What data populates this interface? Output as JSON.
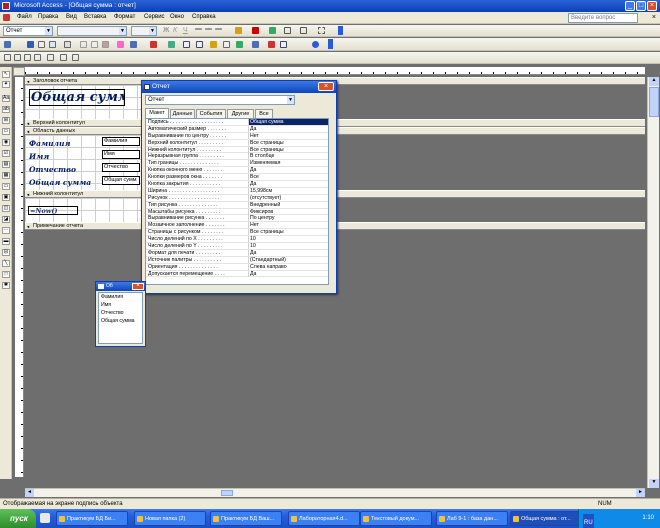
{
  "window": {
    "title": "Microsoft Access - [Общая сумма : отчет]"
  },
  "menu": {
    "items": [
      "Файл",
      "Правка",
      "Вид",
      "Вставка",
      "Формат",
      "Сервис",
      "Окно",
      "Справка"
    ],
    "ask_placeholder": "Введите вопрос"
  },
  "toolbar": {
    "object_combo": "Отчет",
    "font_combo": "",
    "size_combo": ""
  },
  "report": {
    "sections": {
      "report_header": "Заголовок отчета",
      "page_header": "Верхний колонтитул",
      "detail": "Область данных",
      "page_footer": "Нижний колонтитул",
      "report_footer": "Примечание отчета"
    },
    "title_label": "Общая сумма",
    "labels": [
      "Фамилия",
      "Имя",
      "Отчество",
      "Общая сумма"
    ],
    "fields": [
      "Фамилия",
      "Имя",
      "Отчество",
      "Общая сумм"
    ],
    "page_expr": "=Now()"
  },
  "properties": {
    "title": "Отчет",
    "object": "Отчет",
    "tabs": [
      "Макет",
      "Данные",
      "События",
      "Другие",
      "Все"
    ],
    "active_tab": "Макет",
    "rows": [
      {
        "name": "Подпись . . . . . . . . . . . . . . . . . . .",
        "value": "Общая сумма"
      },
      {
        "name": "Автоматический размер . . . . . . .",
        "value": "Да"
      },
      {
        "name": "Выравнивание по центру . . . . . .",
        "value": "Нет"
      },
      {
        "name": "Верхний колонтитул . . . . . . . . .",
        "value": "Все страницы"
      },
      {
        "name": "Нижний колонтитул . . . . . . . . .",
        "value": "Все страницы"
      },
      {
        "name": "Неразрывная группа . . . . . . . . .",
        "value": "В столбце"
      },
      {
        "name": "Тип границы . . . . . . . . . . . . . .",
        "value": "Изменяемая"
      },
      {
        "name": "Кнопка оконного меню . . . . . . .",
        "value": "Да"
      },
      {
        "name": "Кнопки размеров окна . . . . . . .",
        "value": "Все"
      },
      {
        "name": "Кнопка закрытия . . . . . . . . . . .",
        "value": "Да"
      },
      {
        "name": "Ширина . . . . . . . . . . . . . . . . . .",
        "value": "15,998см"
      },
      {
        "name": "Рисунок . . . . . . . . . . . . . . . . . .",
        "value": "(отсутствует)"
      },
      {
        "name": "Тип рисунка . . . . . . . . . . . . . .",
        "value": "Внедренный"
      },
      {
        "name": "Масштабы рисунка . . . . . . . . .",
        "value": "Фиксиров"
      },
      {
        "name": "Выравнивание рисунка . . . . . . .",
        "value": "По центру"
      },
      {
        "name": "Мозаичное заполнение . . . . . . .",
        "value": "Нет"
      },
      {
        "name": "Страницы с рисунком . . . . . . . .",
        "value": "Все страницы"
      },
      {
        "name": "Число делений по X . . . . . . . . .",
        "value": "10"
      },
      {
        "name": "Число делений по Y . . . . . . . . .",
        "value": "10"
      },
      {
        "name": "Формат для печати . . . . . . . . .",
        "value": "Да"
      },
      {
        "name": "Источник палитры . . . . . . . . . .",
        "value": "(Стандартный)"
      },
      {
        "name": "Ориентация . . . . . . . . . . . . . .",
        "value": "Слева направо"
      },
      {
        "name": "Допускается перемещение . . . .",
        "value": "Да"
      }
    ]
  },
  "fieldlist": {
    "title": "Об",
    "items": [
      "Фамилия",
      "Имя",
      "Отчество",
      "Общая сумма"
    ]
  },
  "status": {
    "text": "Отображаемая на экране подпись объекта",
    "mode": "NUM"
  },
  "taskbar": {
    "start": "пуск",
    "tasks": [
      "Практикум БД Би...",
      "Новая папка (2)",
      "Практикум БД Ваш...",
      "Лабораторная4.d...",
      "Текстовый докум...",
      "Лаб 9-1 : база дан...",
      "Общая сумма : от..."
    ],
    "lang": "RU",
    "clock": "1:10"
  },
  "colors": {
    "titlebar": "#0a3fb5",
    "taskbar": "#245ddb",
    "selection": "#0a246a",
    "label_text": "#001a66"
  }
}
